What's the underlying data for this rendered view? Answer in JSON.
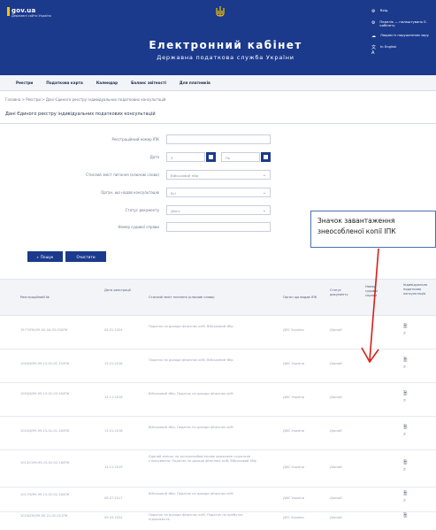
{
  "header": {
    "logo": "gov.ua",
    "logo_sub": "Державні сайти України",
    "title": "Електронний кабінет",
    "subtitle": "Державна податкова служба України",
    "right_links": [
      {
        "icon": "⚙",
        "label": "Вхід"
      },
      {
        "icon": "⚙",
        "label": "Перелік — налаштувань Е-кабінету"
      },
      {
        "icon": "☁",
        "label": "Людям із порушенням зору"
      },
      {
        "icon": "文A",
        "label": "In English"
      }
    ]
  },
  "nav": [
    "Реєстри",
    "Податкова карта",
    "Календар",
    "Баланс звітності",
    "Для платників"
  ],
  "breadcrumb": "Головна  >  Реєстри  >  Дані Єдиного реєстру індивідуальних податкових консультацій",
  "page_title": "Дані Єдиного реєстру індивідуальних податкових консультацій",
  "form": {
    "reg_number_label": "Реєстраційний номер ІПК",
    "date_label": "Дата",
    "date_from": "З",
    "date_to": "По",
    "article_label": "Стислий зміст питання (ключові слова)",
    "article_value": "Військовий збір",
    "authority_label": "Орган, що надав консультацію",
    "authority_value": "Всі",
    "status_label": "Статус документу",
    "status_value": "Діючі",
    "court_label": "Номер судової справи"
  },
  "buttons": {
    "search": "Пошук",
    "clear": "Очистити"
  },
  "callout": {
    "line1": "Значок завантаження",
    "line2": "знеособленої копії ІПК"
  },
  "table": {
    "headers": [
      "Реєстраційний №",
      "Дата реєстрації",
      "Стислий зміст питання (ключові слова)",
      "Орган що видав ІПК",
      "Статус документу",
      "Номер судової справи",
      "Індивідуальна податкова консультація"
    ],
    "rows": [
      {
        "num": "1577/ІПК/99-00-04-03-03/ІПК",
        "date": "04.01.2024",
        "topic": "Податок на доходи фізичних осіб; Військовий збір",
        "org": "ДПС України",
        "status": "Діючий"
      },
      {
        "num": "1003/6/99-99-13-01-01-15/ІПК",
        "date": "13.01.2018",
        "topic": "Податок на доходи фізичних осіб; Військовий збір",
        "org": "ДФС України",
        "status": "Діючий"
      },
      {
        "num": "1003/6/99-99-13-02-03-16/ІПК",
        "date": "14.11.2018",
        "topic": "Військовий збір; Податок на доходи фізичних осіб",
        "org": "ДФС України",
        "status": "Діючий"
      },
      {
        "num": "1015/6/99-99-13-01-01-16/ІПК",
        "date": "13.01.2018",
        "topic": "Військовий збір; Податок на доходи фізичних осіб",
        "org": "ДФС України",
        "status": "Діючий"
      },
      {
        "num": "1013/С/99-99-13-02-02-16/ІПК",
        "date": "14.11.2019",
        "topic": "Єдиний внесок на загальнообов'язкове державне соціальне страхування; Податок на доходи фізичних осіб; Військовий збір",
        "org": "ДФС України",
        "status": "Діючий"
      },
      {
        "num": "1017/6/99-99-13-02-02-16/ІПК",
        "date": "06.07.2017",
        "topic": "Військовий збір; Податок на доходи фізичних осіб",
        "org": "ДФС України",
        "status": "Діючий"
      },
      {
        "num": "1023/ІПК/99-00-21-02-02-ІПК",
        "date": "09.03.2024",
        "topic": "Податок на доходи фізичних осіб; Податок на прибуток підприємств",
        "org": "ДПС України",
        "status": "Діючий"
      }
    ]
  }
}
